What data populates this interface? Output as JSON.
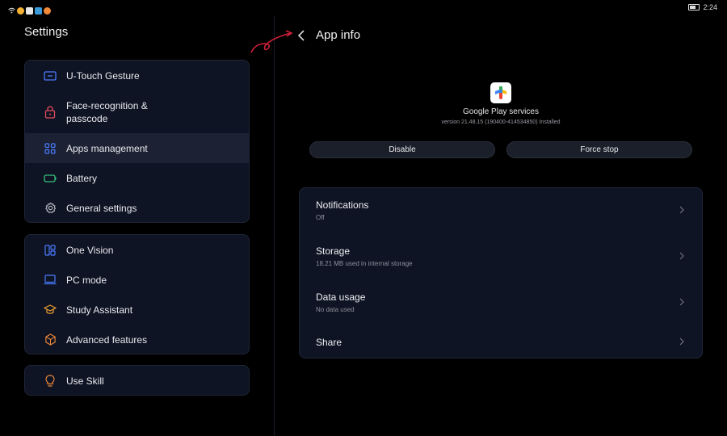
{
  "status_bar": {
    "time": "2:24"
  },
  "left": {
    "title": "Settings",
    "group1": [
      {
        "label": "U-Touch Gesture",
        "icon": "gesture-icon"
      },
      {
        "label": "Face-recognition & passcode",
        "icon": "lock-icon"
      },
      {
        "label": "Apps management",
        "icon": "apps-grid-icon"
      },
      {
        "label": "Battery",
        "icon": "battery-icon"
      },
      {
        "label": "General settings",
        "icon": "gear-icon"
      }
    ],
    "group2": [
      {
        "label": "One Vision",
        "icon": "split-screen-icon"
      },
      {
        "label": "PC mode",
        "icon": "laptop-icon"
      },
      {
        "label": "Study Assistant",
        "icon": "graduation-cap-icon"
      },
      {
        "label": "Advanced features",
        "icon": "hexagon-icon"
      }
    ],
    "group3": [
      {
        "label": "Use Skill",
        "icon": "lightbulb-icon"
      }
    ]
  },
  "right": {
    "title": "App info",
    "app": {
      "name": "Google Play services",
      "version": "version 21.48.15 (190400-414534850) Installed"
    },
    "buttons": {
      "disable": "Disable",
      "force_stop": "Force stop"
    },
    "rows": [
      {
        "title": "Notifications",
        "sub": "Off"
      },
      {
        "title": "Storage",
        "sub": "18.21 MB used in internal storage"
      },
      {
        "title": "Data usage",
        "sub": "No data used"
      },
      {
        "title": "Share",
        "sub": ""
      }
    ]
  },
  "colors": {
    "background": "#000000",
    "card": "#0f1424",
    "accent_blue": "#4a7bff",
    "accent_red": "#e24b5c",
    "accent_green": "#35c27a",
    "accent_orange": "#f08a3a",
    "annotation_red": "#d0213a"
  }
}
